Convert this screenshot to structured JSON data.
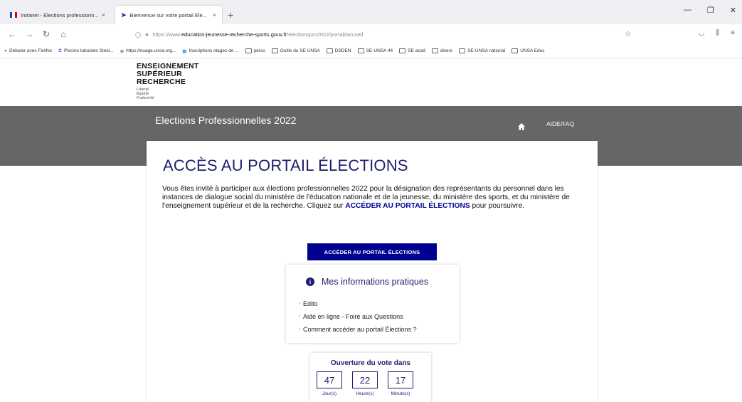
{
  "browser": {
    "tabs": [
      {
        "label": "Intranet - Elections professionn..."
      },
      {
        "label": "Bienvenue sur votre portail Ele..."
      }
    ],
    "new_tab": "+",
    "url_prefix": "https://www.",
    "url_host": "education-jeunesse-recherche-sports.gouv.fr",
    "url_path": "/electionspro2022/portail/accueil",
    "bookmarks": [
      "Débuter avec Firefox",
      "Piscine tubulaire Steel...",
      "https://nuage.unsa.org...",
      "Inscriptions stages de ...",
      "perso",
      "Outils du SE UNSA",
      "DSDEN",
      "SE-UNSA 44",
      "SE acad",
      "divers",
      "SE-UNSA national",
      "UNSA Educ"
    ]
  },
  "header": {
    "logo_lines": [
      "ENSEIGNEMENT",
      "SUPÉRIEUR",
      "RECHERCHE"
    ],
    "motto": [
      "Liberté",
      "Égalité",
      "Fraternité"
    ],
    "site_title": "Elections Professionnelles 2022",
    "aide_link": "AIDE/FAQ"
  },
  "main": {
    "title": "ACCÈS AU PORTAIL ÉLECTIONS",
    "intro": "Vous êtes invité à participer aux élections professionnelles 2022 pour la désignation des représentants du personnel dans les instances de dialogue social du ministère de l'éducation nationale et de la jeunesse, du ministère des sports, et du ministère de l'enseignement supérieur et de la recherche. Cliquez sur ",
    "intro_strong": "ACCÉDER AU PORTAIL ÉLECTIONS",
    "intro_end": " pour poursuivre.",
    "button_label": "ACCÉDER AU PORTAIL ÉLECTIONS"
  },
  "info": {
    "title": "Mes informations pratiques",
    "links": [
      "Edito",
      "Aide en ligne - Foire aux Questions",
      "Comment accéder au portail Élections ?"
    ]
  },
  "countdown": {
    "title": "Ouverture du vote dans",
    "units": [
      {
        "value": "47",
        "label": "Jour(s)"
      },
      {
        "value": "22",
        "label": "Heure(s)"
      },
      {
        "value": "17",
        "label": "Minute(s)"
      }
    ]
  },
  "colors": {
    "brand_blue": "#000091",
    "title_blue": "#1e1e6e",
    "band_gray": "#666666"
  }
}
